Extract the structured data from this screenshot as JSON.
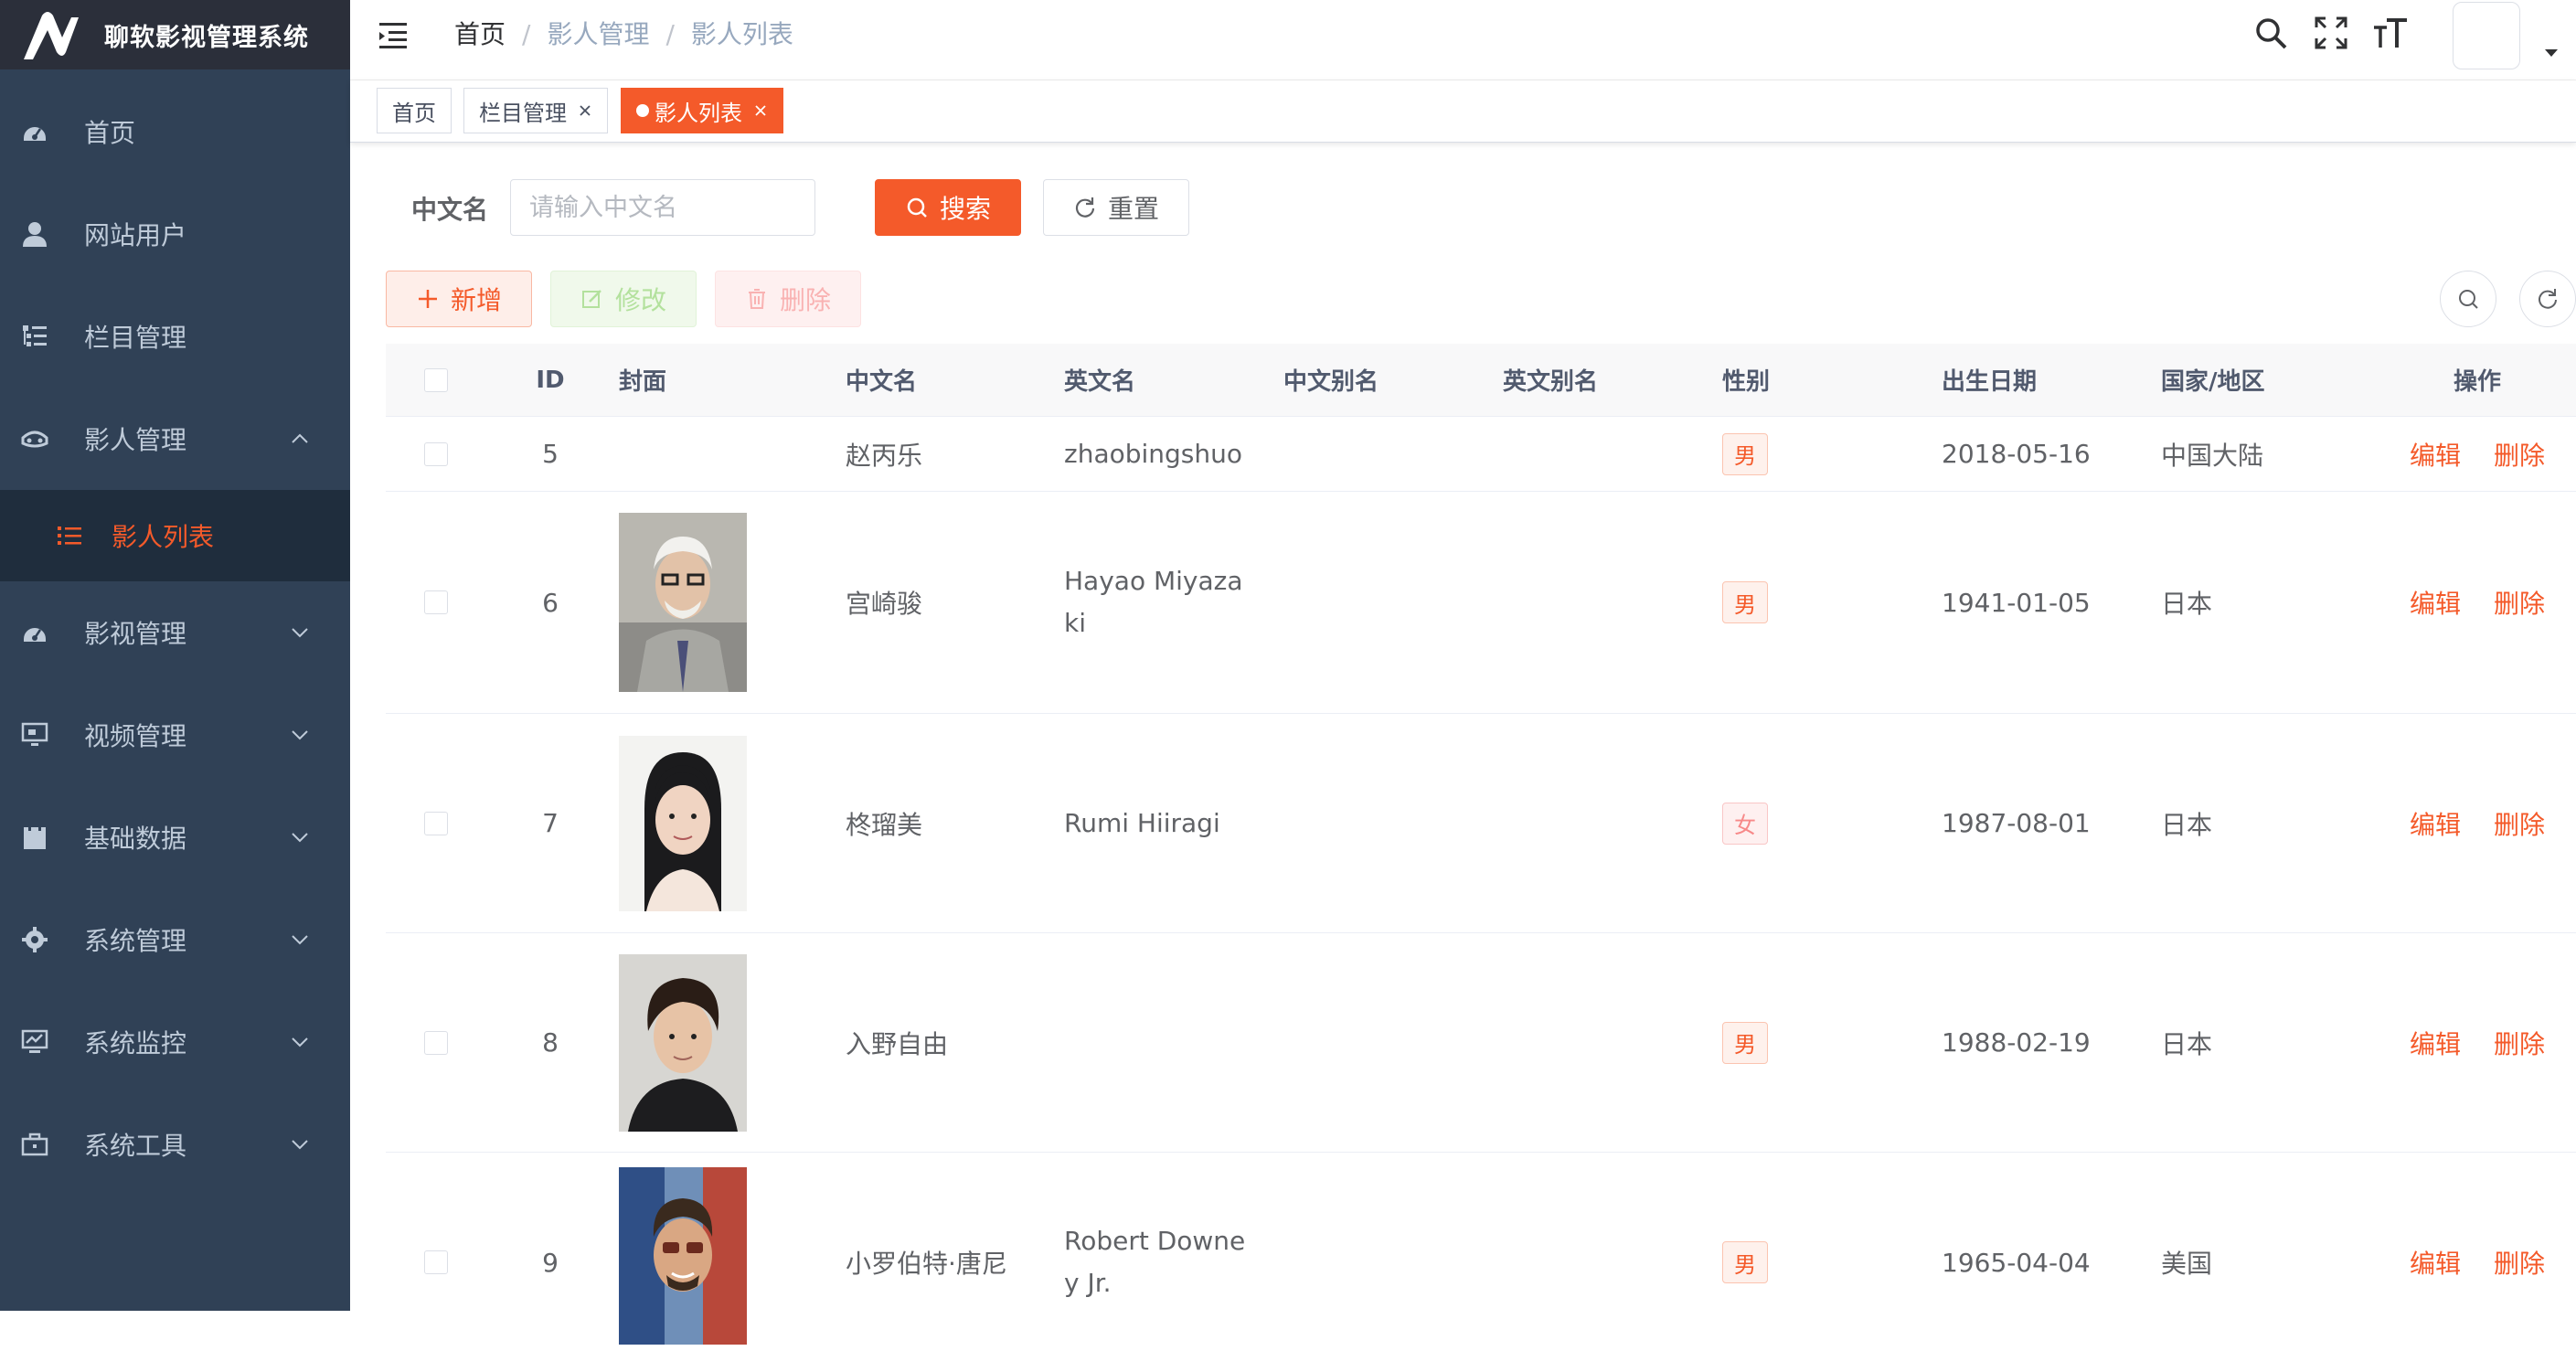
{
  "app": {
    "title": "聊软影视管理系统"
  },
  "sidebar": {
    "items": [
      {
        "label": "首页",
        "icon": "dashboard-icon"
      },
      {
        "label": "网站用户",
        "icon": "user-icon"
      },
      {
        "label": "栏目管理",
        "icon": "tree-table-icon"
      },
      {
        "label": "影人管理",
        "icon": "guide-icon",
        "expanded": true
      },
      {
        "label": "影视管理",
        "icon": "dashboard-icon"
      },
      {
        "label": "视频管理",
        "icon": "monitor-icon"
      },
      {
        "label": "基础数据",
        "icon": "clipboard-icon"
      },
      {
        "label": "系统管理",
        "icon": "gear-icon"
      },
      {
        "label": "系统监控",
        "icon": "monitor-chart-icon"
      },
      {
        "label": "系统工具",
        "icon": "toolbox-icon"
      }
    ],
    "submenu": {
      "label": "影人列表",
      "icon": "list-icon"
    }
  },
  "header": {
    "breadcrumb": [
      "首页",
      "影人管理",
      "影人列表"
    ]
  },
  "tags": [
    {
      "label": "首页"
    },
    {
      "label": "栏目管理"
    },
    {
      "label": "影人列表"
    }
  ],
  "search": {
    "label": "中文名",
    "placeholder": "请输入中文名",
    "value": "",
    "search_button": "搜索",
    "reset_button": "重置"
  },
  "toolbar": {
    "add": "新增",
    "edit": "修改",
    "delete": "删除"
  },
  "table": {
    "columns": [
      "ID",
      "封面",
      "中文名",
      "英文名",
      "中文别名",
      "英文别名",
      "性别",
      "出生日期",
      "国家/地区",
      "操作"
    ],
    "action_edit": "编辑",
    "action_delete": "删除",
    "rows": [
      {
        "id": "5",
        "cover": "",
        "name_cn": "赵丙乐",
        "name_en": "zhaobingshuo",
        "alias_cn": "",
        "alias_en": "",
        "gender": "男",
        "birth": "2018-05-16",
        "region": "中国大陆"
      },
      {
        "id": "6",
        "cover": "photo",
        "name_cn": "宫崎骏",
        "name_en": "Hayao Miyazaki",
        "alias_cn": "",
        "alias_en": "",
        "gender": "男",
        "birth": "1941-01-05",
        "region": "日本"
      },
      {
        "id": "7",
        "cover": "photo",
        "name_cn": "柊瑠美",
        "name_en": "Rumi Hiiragi",
        "alias_cn": "",
        "alias_en": "",
        "gender": "女",
        "birth": "1987-08-01",
        "region": "日本"
      },
      {
        "id": "8",
        "cover": "photo",
        "name_cn": "入野自由",
        "name_en": "",
        "alias_cn": "",
        "alias_en": "",
        "gender": "男",
        "birth": "1988-02-19",
        "region": "日本"
      },
      {
        "id": "9",
        "cover": "photo",
        "name_cn": "小罗伯特·唐尼",
        "name_en": "Robert Downey Jr.",
        "alias_cn": "",
        "alias_en": "",
        "gender": "男",
        "birth": "1965-04-04",
        "region": "美国"
      }
    ]
  },
  "colors": {
    "accent": "#f45a2a",
    "sidebar_bg": "#304156",
    "sidebar_sub_bg": "#1f2d3d"
  }
}
